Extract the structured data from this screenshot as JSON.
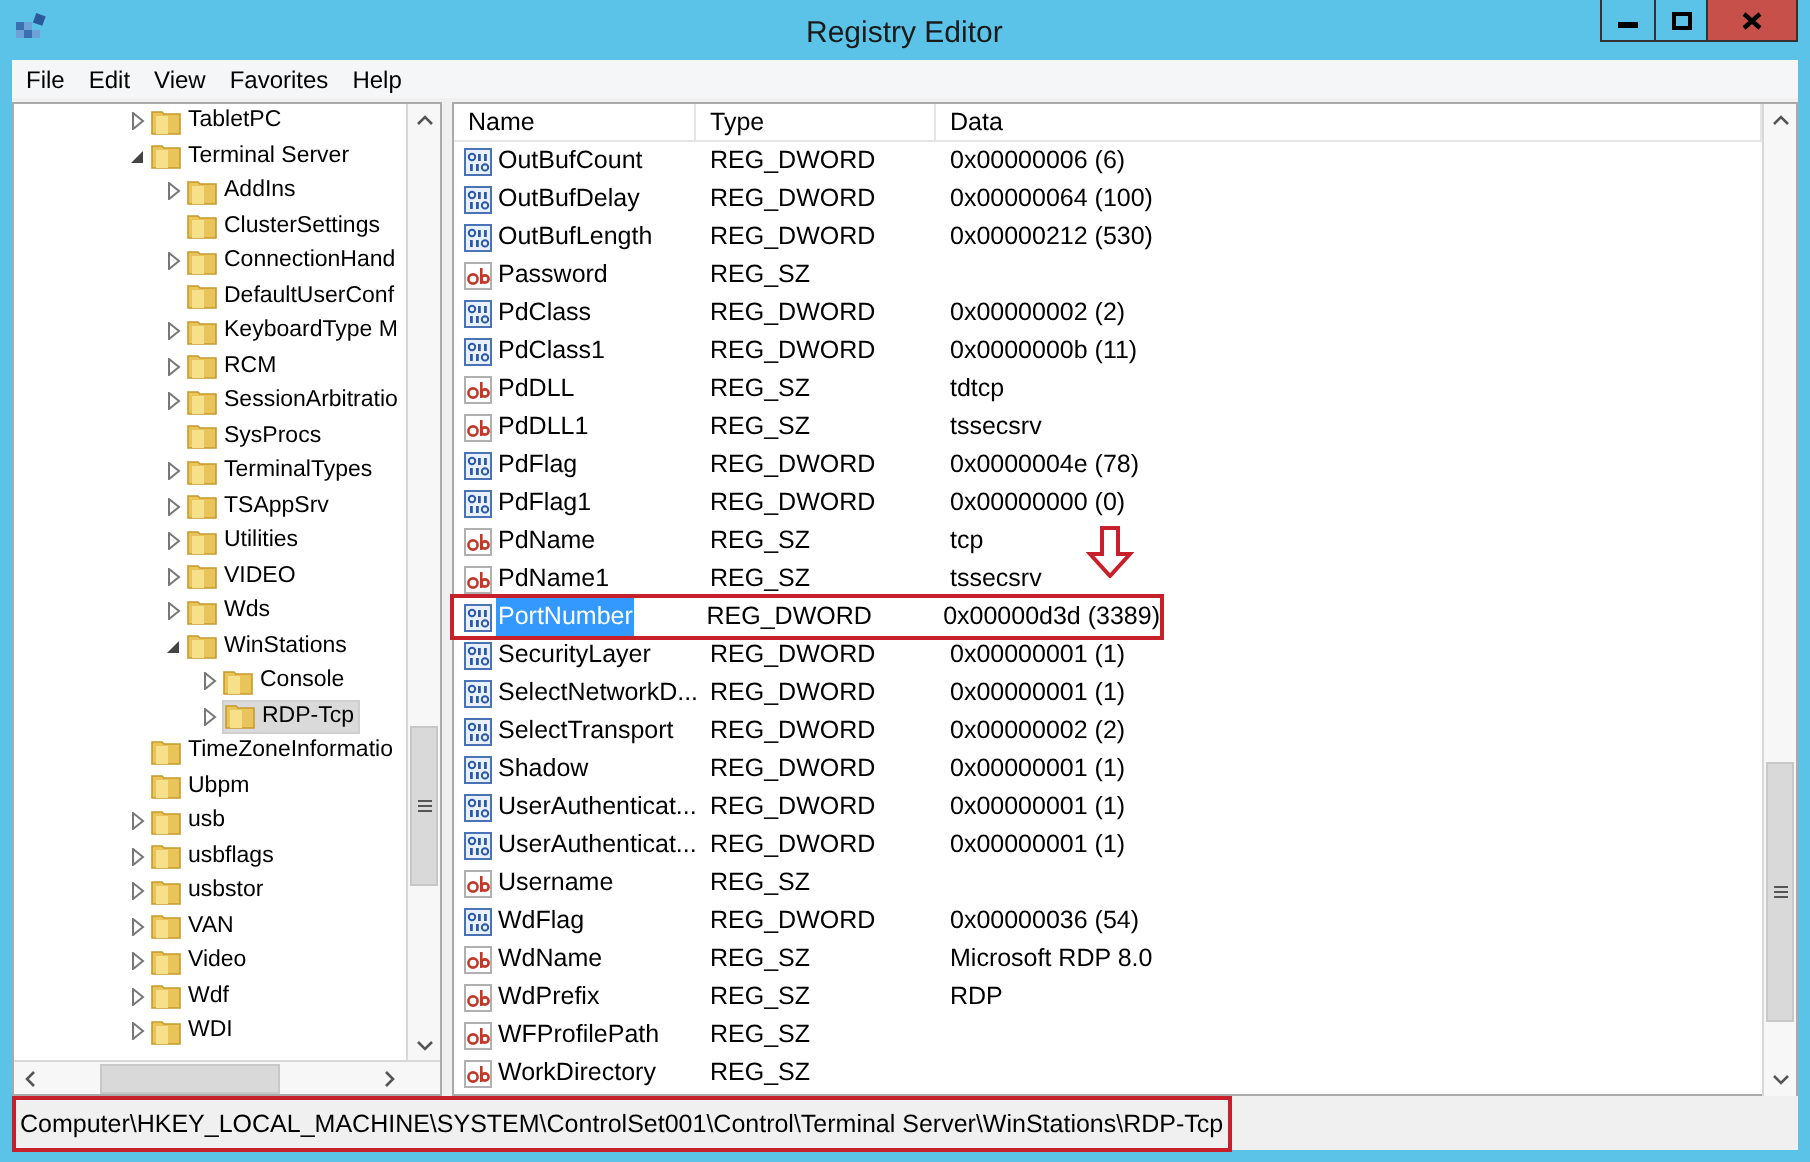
{
  "window": {
    "title": "Registry Editor"
  },
  "menu": [
    "File",
    "Edit",
    "View",
    "Favorites",
    "Help"
  ],
  "tree": [
    {
      "label": "TabletPC",
      "kind": "branch",
      "expanded": false,
      "selected": false
    },
    {
      "label": "Terminal Server",
      "kind": "branch",
      "expanded": true,
      "selected": false,
      "children": [
        {
          "label": "AddIns",
          "kind": "branch",
          "expanded": false,
          "selected": false
        },
        {
          "label": "ClusterSettings",
          "kind": "leaf",
          "selected": false
        },
        {
          "label": "ConnectionHand",
          "kind": "branch",
          "expanded": false,
          "selected": false
        },
        {
          "label": "DefaultUserConf",
          "kind": "leaf",
          "selected": false
        },
        {
          "label": "KeyboardType M",
          "kind": "branch",
          "expanded": false,
          "selected": false
        },
        {
          "label": "RCM",
          "kind": "branch",
          "expanded": false,
          "selected": false
        },
        {
          "label": "SessionArbitratio",
          "kind": "branch",
          "expanded": false,
          "selected": false
        },
        {
          "label": "SysProcs",
          "kind": "leaf",
          "selected": false
        },
        {
          "label": "TerminalTypes",
          "kind": "branch",
          "expanded": false,
          "selected": false
        },
        {
          "label": "TSAppSrv",
          "kind": "branch",
          "expanded": false,
          "selected": false
        },
        {
          "label": "Utilities",
          "kind": "branch",
          "expanded": false,
          "selected": false
        },
        {
          "label": "VIDEO",
          "kind": "branch",
          "expanded": false,
          "selected": false
        },
        {
          "label": "Wds",
          "kind": "branch",
          "expanded": false,
          "selected": false
        },
        {
          "label": "WinStations",
          "kind": "branch",
          "expanded": true,
          "selected": false,
          "children": [
            {
              "label": "Console",
              "kind": "branch",
              "expanded": false,
              "selected": false
            },
            {
              "label": "RDP-Tcp",
              "kind": "branch",
              "expanded": false,
              "selected": true
            }
          ]
        }
      ]
    },
    {
      "label": "TimeZoneInformatio",
      "kind": "leaf",
      "selected": false
    },
    {
      "label": "Ubpm",
      "kind": "leaf",
      "selected": false
    },
    {
      "label": "usb",
      "kind": "branch",
      "expanded": false,
      "selected": false
    },
    {
      "label": "usbflags",
      "kind": "branch",
      "expanded": false,
      "selected": false
    },
    {
      "label": "usbstor",
      "kind": "branch",
      "expanded": false,
      "selected": false
    },
    {
      "label": "VAN",
      "kind": "branch",
      "expanded": false,
      "selected": false
    },
    {
      "label": "Video",
      "kind": "branch",
      "expanded": false,
      "selected": false
    },
    {
      "label": "Wdf",
      "kind": "branch",
      "expanded": false,
      "selected": false
    },
    {
      "label": "WDI",
      "kind": "branch",
      "expanded": false,
      "selected": false
    }
  ],
  "table": {
    "columns": [
      "Name",
      "Type",
      "Data"
    ],
    "rows": [
      {
        "kind": "dword",
        "name": "OutBufCount",
        "type": "REG_DWORD",
        "data": "0x00000006 (6)",
        "selected": false,
        "annotated": false
      },
      {
        "kind": "dword",
        "name": "OutBufDelay",
        "type": "REG_DWORD",
        "data": "0x00000064 (100)",
        "selected": false,
        "annotated": false
      },
      {
        "kind": "dword",
        "name": "OutBufLength",
        "type": "REG_DWORD",
        "data": "0x00000212 (530)",
        "selected": false,
        "annotated": false
      },
      {
        "kind": "sz",
        "name": "Password",
        "type": "REG_SZ",
        "selected": false,
        "annotated": false
      },
      {
        "kind": "dword",
        "name": "PdClass",
        "type": "REG_DWORD",
        "data": "0x00000002 (2)",
        "selected": false,
        "annotated": false
      },
      {
        "kind": "dword",
        "name": "PdClass1",
        "type": "REG_DWORD",
        "data": "0x0000000b (11)",
        "selected": false,
        "annotated": false
      },
      {
        "kind": "sz",
        "name": "PdDLL",
        "type": "REG_SZ",
        "data": "tdtcp",
        "selected": false,
        "annotated": false
      },
      {
        "kind": "sz",
        "name": "PdDLL1",
        "type": "REG_SZ",
        "data": "tssecsrv",
        "selected": false,
        "annotated": false
      },
      {
        "kind": "dword",
        "name": "PdFlag",
        "type": "REG_DWORD",
        "data": "0x0000004e (78)",
        "selected": false,
        "annotated": false
      },
      {
        "kind": "dword",
        "name": "PdFlag1",
        "type": "REG_DWORD",
        "data": "0x00000000 (0)",
        "selected": false,
        "annotated": false
      },
      {
        "kind": "sz",
        "name": "PdName",
        "type": "REG_SZ",
        "data": "tcp",
        "selected": false,
        "annotated": false
      },
      {
        "kind": "sz",
        "name": "PdName1",
        "type": "REG_SZ",
        "data": "tssecsrv",
        "selected": false,
        "annotated": false
      },
      {
        "kind": "dword",
        "name": "PortNumber",
        "type": "REG_DWORD",
        "data": "0x00000d3d (3389)",
        "selected": true,
        "annotated": true
      },
      {
        "kind": "dword",
        "name": "SecurityLayer",
        "type": "REG_DWORD",
        "data": "0x00000001 (1)",
        "selected": false,
        "annotated": false
      },
      {
        "kind": "dword",
        "name": "SelectNetworkD...",
        "type": "REG_DWORD",
        "data": "0x00000001 (1)",
        "selected": false,
        "annotated": false
      },
      {
        "kind": "dword",
        "name": "SelectTransport",
        "type": "REG_DWORD",
        "data": "0x00000002 (2)",
        "selected": false,
        "annotated": false
      },
      {
        "kind": "dword",
        "name": "Shadow",
        "type": "REG_DWORD",
        "data": "0x00000001 (1)",
        "selected": false,
        "annotated": false
      },
      {
        "kind": "dword",
        "name": "UserAuthenticat...",
        "type": "REG_DWORD",
        "data": "0x00000001 (1)",
        "selected": false,
        "annotated": false
      },
      {
        "kind": "dword",
        "name": "UserAuthenticat...",
        "type": "REG_DWORD",
        "data": "0x00000001 (1)",
        "selected": false,
        "annotated": false
      },
      {
        "kind": "sz",
        "name": "Username",
        "type": "REG_SZ",
        "selected": false,
        "annotated": false
      },
      {
        "kind": "dword",
        "name": "WdFlag",
        "type": "REG_DWORD",
        "data": "0x00000036 (54)",
        "selected": false,
        "annotated": false
      },
      {
        "kind": "sz",
        "name": "WdName",
        "type": "REG_SZ",
        "data": "Microsoft RDP 8.0",
        "selected": false,
        "annotated": false
      },
      {
        "kind": "sz",
        "name": "WdPrefix",
        "type": "REG_SZ",
        "data": "RDP",
        "selected": false,
        "annotated": false
      },
      {
        "kind": "sz",
        "name": "WFProfilePath",
        "type": "REG_SZ",
        "selected": false,
        "annotated": false
      },
      {
        "kind": "sz",
        "name": "WorkDirectory",
        "type": "REG_SZ",
        "selected": false,
        "annotated": false
      }
    ]
  },
  "status_bar": {
    "text": "Computer\\HKEY_LOCAL_MACHINE\\SYSTEM\\ControlSet001\\Control\\Terminal Server\\WinStations\\RDP-Tcp",
    "annotated": true
  }
}
